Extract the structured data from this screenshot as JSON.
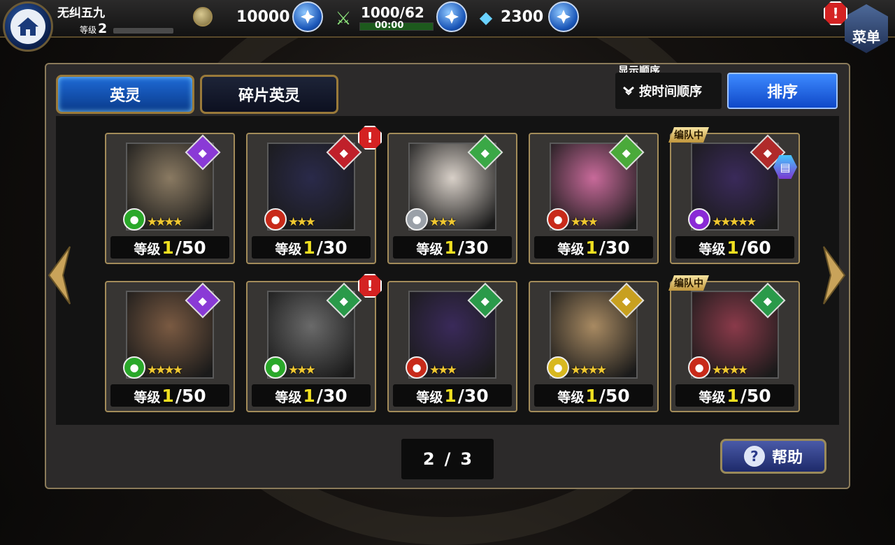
{
  "header": {
    "player_name": "无纠五九",
    "level_label": "等级",
    "level": "2",
    "gold": "10000",
    "stamina": "1000/62",
    "stamina_timer": "00:00",
    "gems": "2300",
    "menu_label": "菜单",
    "alert_symbol": "!"
  },
  "tabs": [
    {
      "label": "英灵",
      "active": true
    },
    {
      "label": "碎片英灵",
      "active": false
    }
  ],
  "sort": {
    "caption": "显示顺序",
    "current": "按时间顺序",
    "button": "排序"
  },
  "cards": [
    {
      "class_icon": "hat-icon",
      "class_color": "#8a3ad6",
      "element": "wind",
      "element_color": "#2aa82a",
      "stars": 4,
      "level_label": "等级",
      "level_current": "1",
      "level_max": "/50",
      "alert": false,
      "team": false
    },
    {
      "class_icon": "sword-icon",
      "class_color": "#c0202a",
      "element": "fire",
      "element_color": "#c82a1a",
      "stars": 3,
      "level_label": "等级",
      "level_current": "1",
      "level_max": "/30",
      "alert": true,
      "team": false
    },
    {
      "class_icon": "heart-icon",
      "class_color": "#3aa846",
      "element": "light",
      "element_color": "#9aa0a8",
      "stars": 3,
      "level_label": "等级",
      "level_current": "1",
      "level_max": "/30",
      "alert": false,
      "team": false
    },
    {
      "class_icon": "guitar-icon",
      "class_color": "#4aaa3a",
      "element": "fire",
      "element_color": "#c82a1a",
      "stars": 3,
      "level_label": "等级",
      "level_current": "1",
      "level_max": "/30",
      "alert": false,
      "team": false
    },
    {
      "class_icon": "spear-icon",
      "class_color": "#b02a2a",
      "element": "dark",
      "element_color": "#8a2ad6",
      "stars": 5,
      "level_label": "等级",
      "level_current": "1",
      "level_max": "/60",
      "alert": false,
      "team": true,
      "team_label": "编队中",
      "extra_icon": "book-icon"
    },
    {
      "class_icon": "hat-icon",
      "class_color": "#8a3ad6",
      "element": "wind",
      "element_color": "#2aa82a",
      "stars": 4,
      "level_label": "等级",
      "level_current": "1",
      "level_max": "/50",
      "alert": false,
      "team": false
    },
    {
      "class_icon": "dagger-icon",
      "class_color": "#2a9a4a",
      "element": "wind",
      "element_color": "#2aa82a",
      "stars": 3,
      "level_label": "等级",
      "level_current": "1",
      "level_max": "/30",
      "alert": true,
      "team": false
    },
    {
      "class_icon": "dagger-icon",
      "class_color": "#2a9a4a",
      "element": "fire",
      "element_color": "#c82a1a",
      "stars": 3,
      "level_label": "等级",
      "level_current": "1",
      "level_max": "/30",
      "alert": false,
      "team": false
    },
    {
      "class_icon": "gun-icon",
      "class_color": "#c8a020",
      "element": "thunder",
      "element_color": "#d8b820",
      "stars": 4,
      "level_label": "等级",
      "level_current": "1",
      "level_max": "/50",
      "alert": false,
      "team": false
    },
    {
      "class_icon": "dagger-icon",
      "class_color": "#2a9a4a",
      "element": "fire",
      "element_color": "#c82a1a",
      "stars": 4,
      "level_label": "等级",
      "level_current": "1",
      "level_max": "/50",
      "alert": false,
      "team": true,
      "team_label": "编队中"
    }
  ],
  "pager": {
    "current": "2",
    "separator": "/",
    "total": "3"
  },
  "help": {
    "label": "帮助",
    "icon": "?"
  }
}
